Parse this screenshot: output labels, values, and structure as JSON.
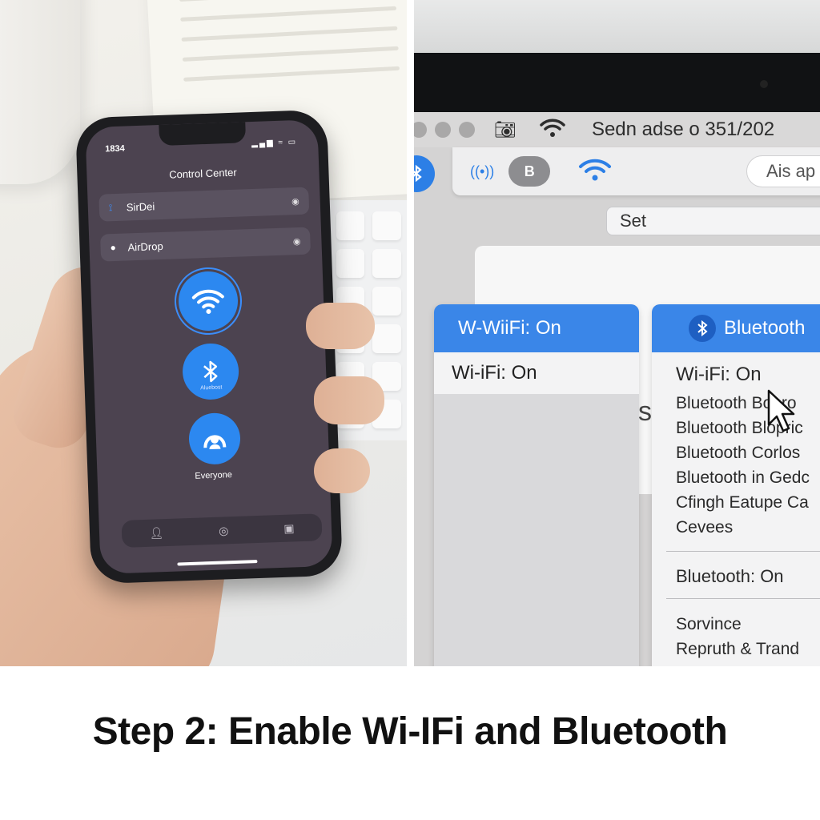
{
  "phone": {
    "status_time": "1834",
    "title": "Control Center",
    "rows": [
      {
        "label": "SirDei",
        "icon": "wifi-icon"
      },
      {
        "label": "AirDrop",
        "icon": "dot-icon"
      }
    ],
    "bluetooth_sublabel": "Aluebost",
    "airdrop_label": "Everyone",
    "dock_icons": [
      "person-icon",
      "target-icon",
      "square-icon"
    ]
  },
  "mac": {
    "menubar_title": "Sedn adse o 351/202",
    "search_placeholder": "Ais ap",
    "toolbar_b": "B",
    "set_field": "Set",
    "wifi_panel": {
      "header": "W-WiiFi: On",
      "row": "Wi-iFi: On"
    },
    "ghost_text": "s",
    "bt_panel": {
      "header": "Bluetooth",
      "wifi_status": "Wi-iFi: On",
      "options": [
        "Bluetooth Bopro",
        "Bluetooth Blopric",
        "Bluetooth Corlos",
        "Bluetooth in Gedc",
        "Cfingh Eatupe Ca",
        "Cevees"
      ],
      "bluetooth_status": "Bluetooth: On",
      "more": [
        "Sorvince",
        "Repruth & Trand"
      ]
    }
  },
  "caption": "Step 2: Enable Wi-IFi and Bluetooth",
  "colors": {
    "accent": "#2c88f0",
    "phone_screen": "#4c4350"
  }
}
